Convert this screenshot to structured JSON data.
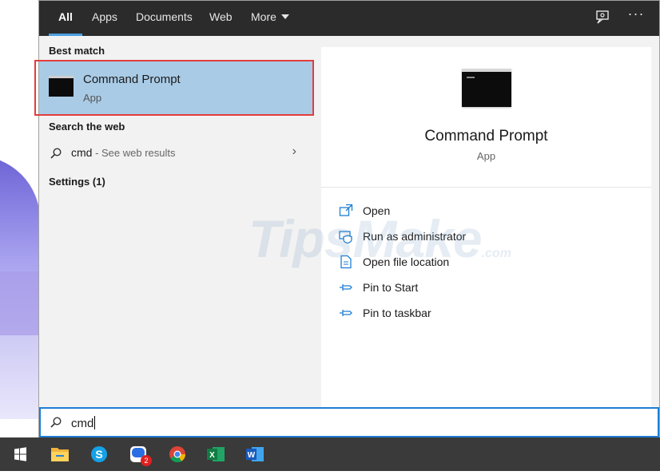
{
  "tabs": [
    {
      "label": "All",
      "active": true
    },
    {
      "label": "Apps"
    },
    {
      "label": "Documents"
    },
    {
      "label": "Web"
    },
    {
      "label": "More"
    }
  ],
  "top_icons": [
    "feedback-icon",
    "more-options-icon"
  ],
  "left": {
    "best_match_heading": "Best match",
    "best_match": {
      "title": "Command Prompt",
      "subtitle": "App",
      "icon": "command-prompt-icon"
    },
    "search_web_heading": "Search the web",
    "web_result": {
      "query": "cmd",
      "suffix": " - See web results"
    },
    "settings_heading": "Settings (1)"
  },
  "right": {
    "title": "Command Prompt",
    "subtitle": "App",
    "actions": [
      {
        "label": "Open",
        "icon": "open-icon"
      },
      {
        "label": "Run as administrator",
        "icon": "admin-shield-icon"
      },
      {
        "label": "Open file location",
        "icon": "file-location-icon"
      },
      {
        "label": "Pin to Start",
        "icon": "pin-icon"
      },
      {
        "label": "Pin to taskbar",
        "icon": "pin-icon"
      }
    ]
  },
  "watermark": {
    "main": "TipsMake",
    "suffix": ".com"
  },
  "search": {
    "value": "cmd"
  },
  "taskbar": {
    "items": [
      "windows-start-icon",
      "file-explorer-icon",
      "skype-icon",
      "zalo-icon",
      "chrome-icon",
      "excel-icon",
      "word-icon"
    ],
    "zalo_badge": "2"
  },
  "colors": {
    "accent": "#1e7ed4",
    "selection": "#a9cbe6",
    "highlight_outline": "#e33d3d",
    "topbar": "#2b2b2b",
    "taskbar": "#3a3a3a"
  }
}
